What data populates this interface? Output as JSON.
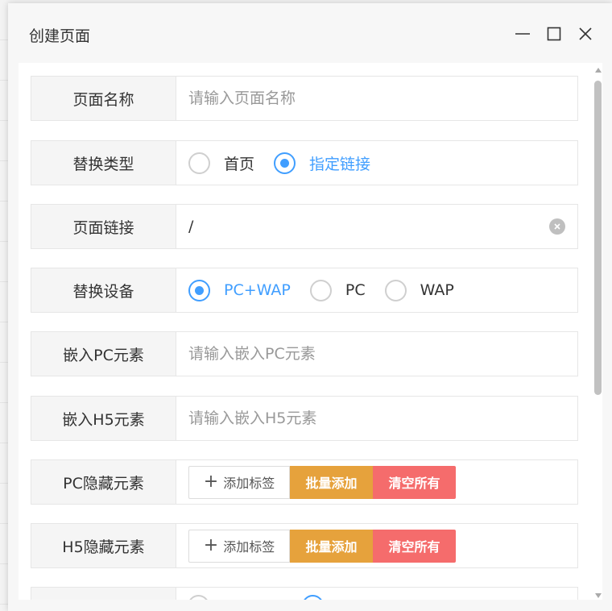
{
  "window": {
    "title": "创建页面"
  },
  "fields": {
    "page_name": {
      "label": "页面名称",
      "placeholder": "请输入页面名称",
      "value": ""
    },
    "replace_type": {
      "label": "替换类型",
      "options": [
        "首页",
        "指定链接"
      ],
      "selected": "指定链接"
    },
    "page_link": {
      "label": "页面链接",
      "value": "/"
    },
    "replace_device": {
      "label": "替换设备",
      "options": [
        "PC+WAP",
        "PC",
        "WAP"
      ],
      "selected": "PC+WAP"
    },
    "embed_pc": {
      "label": "嵌入PC元素",
      "placeholder": "请输入嵌入PC元素",
      "value": ""
    },
    "embed_h5": {
      "label": "嵌入H5元素",
      "placeholder": "请输入嵌入H5元素",
      "value": ""
    },
    "pc_hidden": {
      "label": "PC隐藏元素",
      "add_label": "添加标签",
      "batch_label": "批量添加",
      "clear_label": "清空所有"
    },
    "h5_hidden": {
      "label": "H5隐藏元素",
      "add_label": "添加标签",
      "batch_label": "批量添加",
      "clear_label": "清空所有"
    }
  },
  "colors": {
    "primary": "#409eff",
    "warning": "#e6a23c",
    "danger": "#f56c6c"
  }
}
